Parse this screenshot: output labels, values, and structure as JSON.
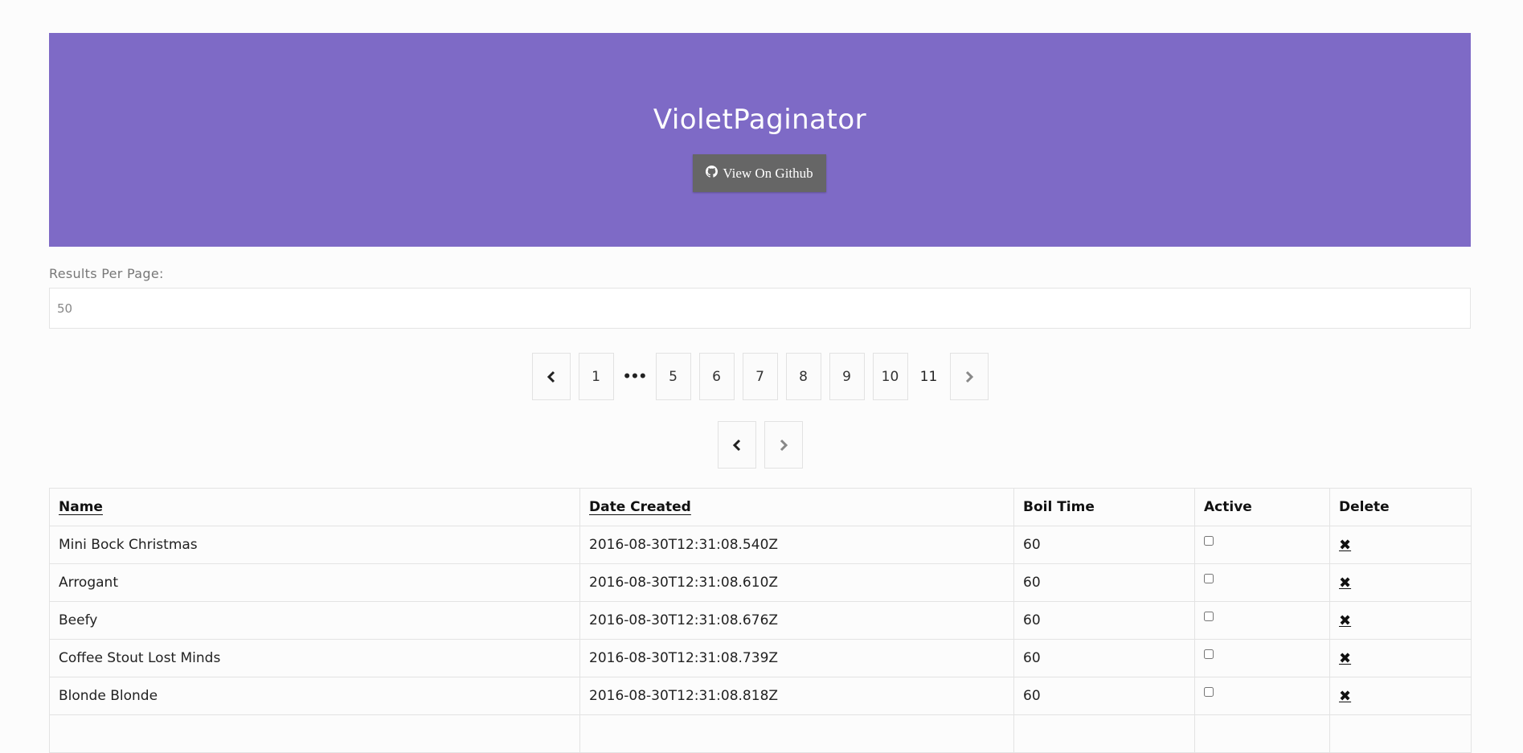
{
  "hero": {
    "title": "VioletPaginator",
    "github_button_label": "View On Github",
    "background_color": "#7e6ac6",
    "button_color": "#666666"
  },
  "results_per_page": {
    "label": "Results Per Page:",
    "value": "50"
  },
  "pagination": {
    "pages": [
      "1",
      "5",
      "6",
      "7",
      "8",
      "9",
      "10",
      "11"
    ],
    "ellipsis": "•••",
    "current_page": "11",
    "prev_icon": "chevron-left-icon",
    "next_icon": "chevron-right-icon"
  },
  "table": {
    "headers": {
      "name": "Name",
      "date_created": "Date Created",
      "boil_time": "Boil Time",
      "active": "Active",
      "delete": "Delete"
    },
    "delete_symbol": "✖",
    "rows": [
      {
        "name": "Mini Bock Christmas",
        "date_created": "2016-08-30T12:31:08.540Z",
        "boil_time": "60",
        "active": false
      },
      {
        "name": "Arrogant",
        "date_created": "2016-08-30T12:31:08.610Z",
        "boil_time": "60",
        "active": false
      },
      {
        "name": "Beefy",
        "date_created": "2016-08-30T12:31:08.676Z",
        "boil_time": "60",
        "active": false
      },
      {
        "name": "Coffee Stout Lost Minds",
        "date_created": "2016-08-30T12:31:08.739Z",
        "boil_time": "60",
        "active": false
      },
      {
        "name": "Blonde Blonde",
        "date_created": "2016-08-30T12:31:08.818Z",
        "boil_time": "60",
        "active": false
      }
    ]
  }
}
